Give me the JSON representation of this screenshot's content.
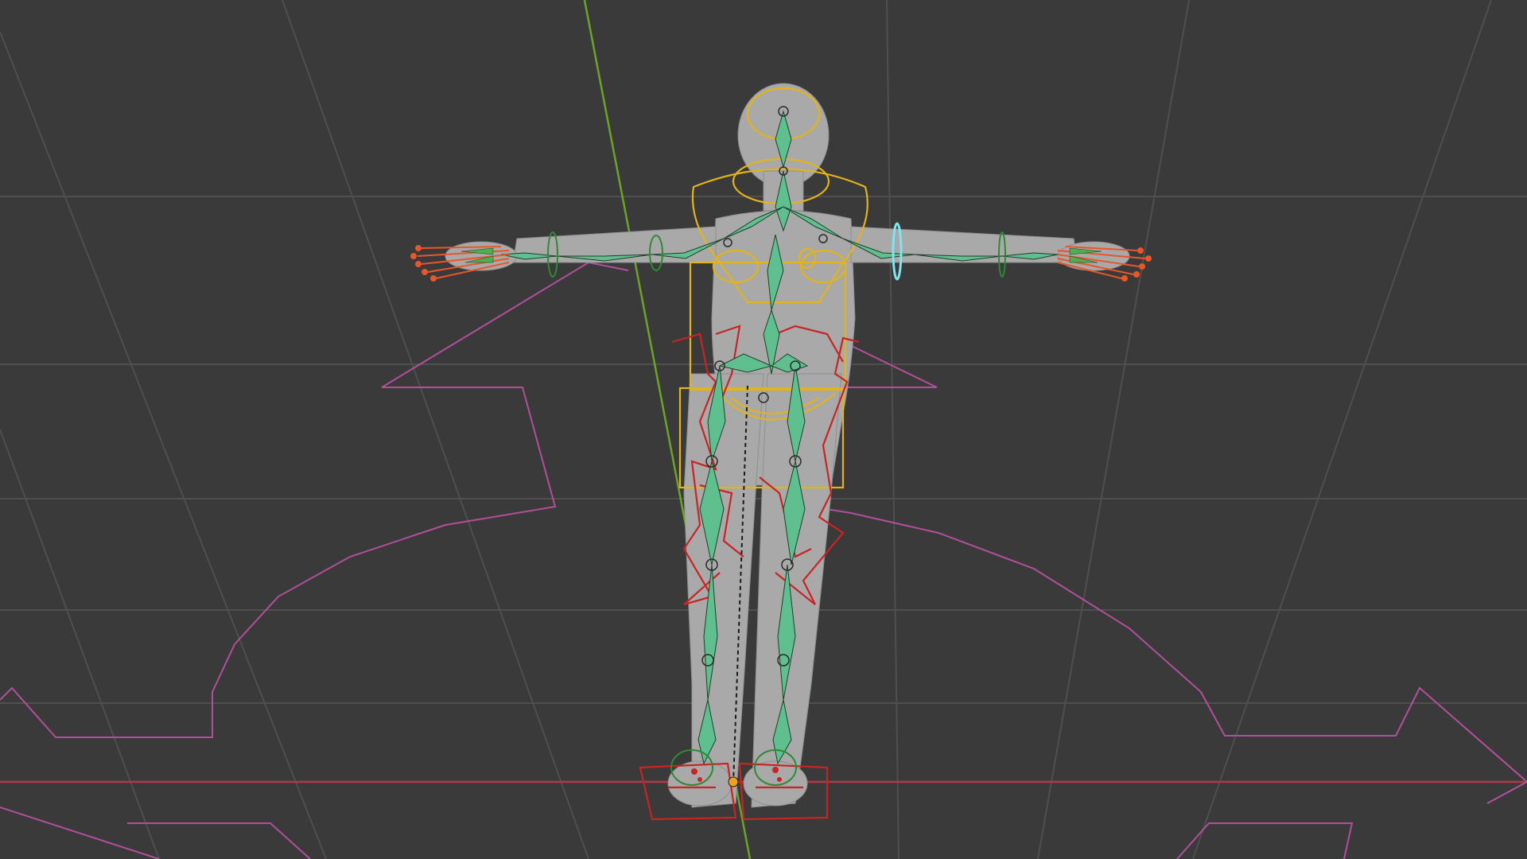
{
  "viewport": {
    "background": "#3a3a3a",
    "grid_color": "#4d4d4d",
    "x_axis_color": "#c8324b",
    "y_axis_color": "#6ba12a",
    "mesh_color": "#b9b9b9",
    "bone_color": "#5fbf8f",
    "ik_control_color": "#d42a2a",
    "torso_control_color": "#e0b21c",
    "root_control_color": "#b04f9a",
    "finger_control_color": "#e8562a",
    "selected_control_color": "#7fe3f0",
    "origin_marker_color": "#f0a020"
  },
  "objects": {
    "character": "character-mesh",
    "armature": "rig-armature",
    "root": "root-control"
  }
}
